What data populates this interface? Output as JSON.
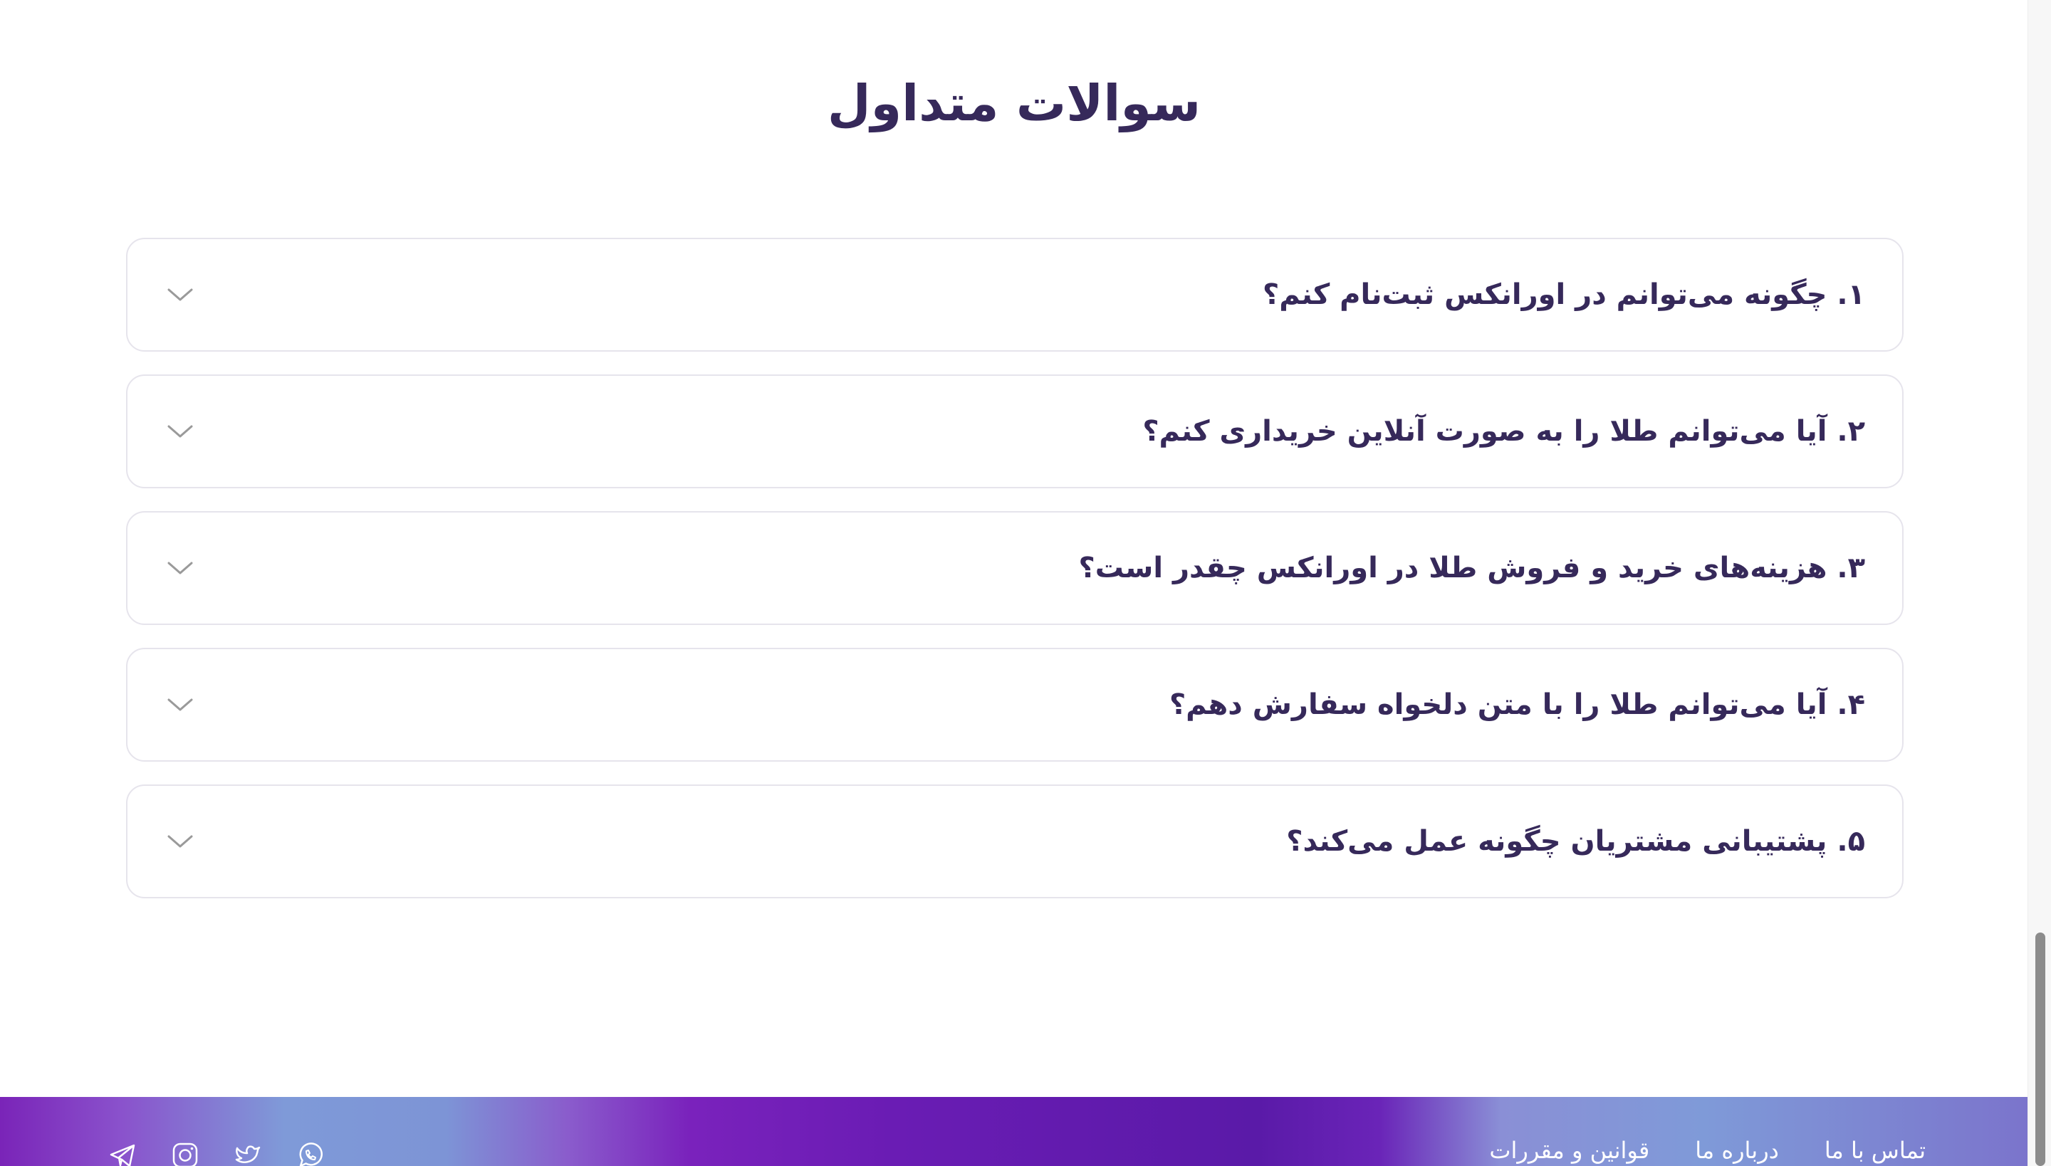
{
  "faq": {
    "title": "سوالات متداول",
    "items": [
      {
        "question": "۱. چگونه می‌توانم در اورانکس ثبت‌نام کنم؟"
      },
      {
        "question": "۲. آیا می‌توانم طلا را به صورت آنلاین خریداری کنم؟"
      },
      {
        "question": "۳. هزینه‌های خرید و فروش طلا در اورانکس چقدر است؟"
      },
      {
        "question": "۴. آیا می‌توانم طلا را با متن دلخواه سفارش دهم؟"
      },
      {
        "question": "۵. پشتیبانی مشتریان چگونه عمل می‌کند؟"
      }
    ]
  },
  "footer": {
    "links": [
      {
        "label": "تماس با ما"
      },
      {
        "label": "درباره ما"
      },
      {
        "label": "قوانین و مقررات"
      }
    ],
    "socials": [
      {
        "icon": "whatsapp-icon"
      },
      {
        "icon": "twitter-icon"
      },
      {
        "icon": "instagram-icon"
      },
      {
        "icon": "telegram-icon"
      }
    ]
  },
  "colors": {
    "heading": "#36295a",
    "border": "#e6e4ec",
    "chevron": "#9a9a9a",
    "footer_primary": "#5a1aa8",
    "footer_accent": "#7f9ad8"
  }
}
